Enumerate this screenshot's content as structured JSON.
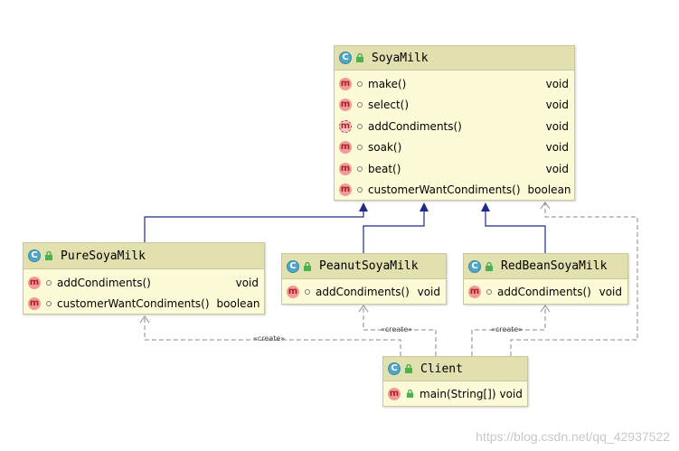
{
  "classes": {
    "soyamilk": {
      "name": "SoyaMilk",
      "methods": [
        {
          "sig": "make()",
          "type": "void"
        },
        {
          "sig": "select()",
          "type": "void"
        },
        {
          "sig": "addCondiments()",
          "type": "void"
        },
        {
          "sig": "soak()",
          "type": "void"
        },
        {
          "sig": "beat()",
          "type": "void"
        },
        {
          "sig": "customerWantCondiments()",
          "type": "boolean"
        }
      ]
    },
    "pure": {
      "name": "PureSoyaMilk",
      "methods": [
        {
          "sig": "addCondiments()",
          "type": "void"
        },
        {
          "sig": "customerWantCondiments()",
          "type": "boolean"
        }
      ]
    },
    "peanut": {
      "name": "PeanutSoyaMilk",
      "methods": [
        {
          "sig": "addCondiments()",
          "type": "void"
        }
      ]
    },
    "redbean": {
      "name": "RedBeanSoyaMilk",
      "methods": [
        {
          "sig": "addCondiments()",
          "type": "void"
        }
      ]
    },
    "client": {
      "name": "Client",
      "methods": [
        {
          "sig": "main(String[])",
          "type": "void"
        }
      ]
    }
  },
  "labels": {
    "create": "«create»"
  },
  "watermark": "https://blog.csdn.net/qq_42937522",
  "colors": {
    "class_fill": "#fdfbd7",
    "header_fill": "#e1e0ae",
    "inheritance": "#1f2a8c",
    "dependency": "#8a8a8a"
  }
}
